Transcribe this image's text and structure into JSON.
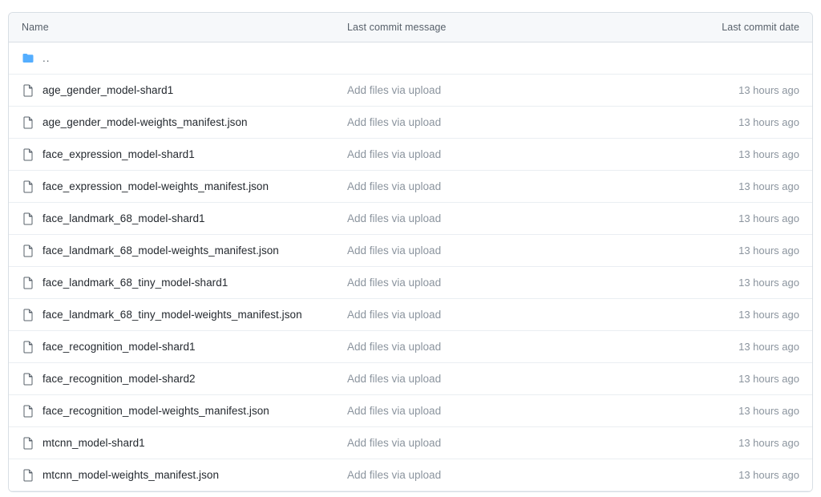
{
  "table": {
    "columns": {
      "name": "Name",
      "message": "Last commit message",
      "date": "Last commit date"
    },
    "colors": {
      "header_bg": "#f6f8fa",
      "border": "#d8dee4",
      "row_divider": "#eaeef2",
      "folder_icon": "#54aeff",
      "file_icon": "#57606a",
      "name_text": "#24292f",
      "muted_text": "#8b949e"
    },
    "rows": [
      {
        "icon": "folder-icon",
        "type": "directory",
        "name": "..",
        "message": "",
        "date": ""
      },
      {
        "icon": "file-icon",
        "type": "file",
        "name": "age_gender_model-shard1",
        "message": "Add files via upload",
        "date": "13 hours ago"
      },
      {
        "icon": "file-icon",
        "type": "file",
        "name": "age_gender_model-weights_manifest.json",
        "message": "Add files via upload",
        "date": "13 hours ago"
      },
      {
        "icon": "file-icon",
        "type": "file",
        "name": "face_expression_model-shard1",
        "message": "Add files via upload",
        "date": "13 hours ago"
      },
      {
        "icon": "file-icon",
        "type": "file",
        "name": "face_expression_model-weights_manifest.json",
        "message": "Add files via upload",
        "date": "13 hours ago"
      },
      {
        "icon": "file-icon",
        "type": "file",
        "name": "face_landmark_68_model-shard1",
        "message": "Add files via upload",
        "date": "13 hours ago"
      },
      {
        "icon": "file-icon",
        "type": "file",
        "name": "face_landmark_68_model-weights_manifest.json",
        "message": "Add files via upload",
        "date": "13 hours ago"
      },
      {
        "icon": "file-icon",
        "type": "file",
        "name": "face_landmark_68_tiny_model-shard1",
        "message": "Add files via upload",
        "date": "13 hours ago"
      },
      {
        "icon": "file-icon",
        "type": "file",
        "name": "face_landmark_68_tiny_model-weights_manifest.json",
        "message": "Add files via upload",
        "date": "13 hours ago"
      },
      {
        "icon": "file-icon",
        "type": "file",
        "name": "face_recognition_model-shard1",
        "message": "Add files via upload",
        "date": "13 hours ago"
      },
      {
        "icon": "file-icon",
        "type": "file",
        "name": "face_recognition_model-shard2",
        "message": "Add files via upload",
        "date": "13 hours ago"
      },
      {
        "icon": "file-icon",
        "type": "file",
        "name": "face_recognition_model-weights_manifest.json",
        "message": "Add files via upload",
        "date": "13 hours ago"
      },
      {
        "icon": "file-icon",
        "type": "file",
        "name": "mtcnn_model-shard1",
        "message": "Add files via upload",
        "date": "13 hours ago"
      },
      {
        "icon": "file-icon",
        "type": "file",
        "name": "mtcnn_model-weights_manifest.json",
        "message": "Add files via upload",
        "date": "13 hours ago"
      }
    ]
  }
}
